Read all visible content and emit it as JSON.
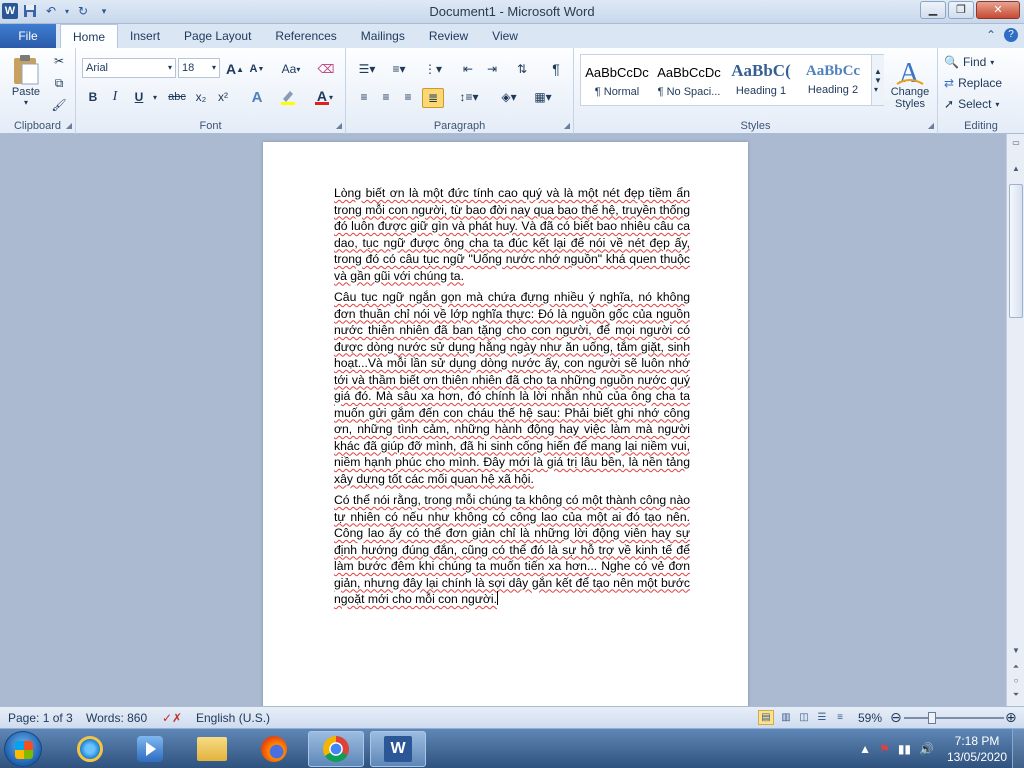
{
  "window": {
    "title": "Document1  -  Microsoft Word"
  },
  "qat": {
    "app_icon": "W",
    "save": "💾",
    "undo": "↶",
    "redo": "↻"
  },
  "tabs": {
    "file": "File",
    "items": [
      "Home",
      "Insert",
      "Page Layout",
      "References",
      "Mailings",
      "Review",
      "View"
    ],
    "active": "Home"
  },
  "ribbon": {
    "clipboard": {
      "label": "Clipboard",
      "paste": "Paste"
    },
    "font": {
      "label": "Font",
      "name": "Arial",
      "size": "18",
      "bold": "B",
      "italic": "I",
      "underline": "U",
      "strike": "abc",
      "sub": "x₂",
      "sup": "x²",
      "grow": "A",
      "shrink": "A",
      "case": "Aa",
      "color": "A"
    },
    "paragraph": {
      "label": "Paragraph",
      "pilcrow": "¶"
    },
    "styles": {
      "label": "Styles",
      "items": [
        {
          "preview": "AaBbCcDc",
          "name": "¶ Normal"
        },
        {
          "preview": "AaBbCcDc",
          "name": "¶ No Spaci..."
        },
        {
          "preview": "AaBbC(",
          "name": "Heading 1"
        },
        {
          "preview": "AaBbCc",
          "name": "Heading 2"
        }
      ],
      "change_styles": "Change Styles"
    },
    "editing": {
      "label": "Editing",
      "find": "Find",
      "replace": "Replace",
      "select": "Select"
    }
  },
  "document": {
    "paragraphs": [
      "Lòng biết ơn là một đức tính cao quý và là một nét đẹp tiềm ẩn trong mỗi con người, từ bao đời nay qua bao thế hệ, truyền thống đó luôn được giữ gìn và phát huy. Và đã có biết bao nhiêu câu ca dao, tục ngữ được ông cha ta đúc kết lại để nói về nét đẹp ấy, trong đó có câu tục ngữ \"Uống nước nhớ nguồn\" khá quen thuộc và gần gũi với chúng ta.",
      "Câu tục ngữ ngắn gọn mà chứa đựng nhiều ý nghĩa, nó không đơn thuần chỉ nói về lớp nghĩa thực: Đó là nguồn gốc của nguồn nước thiên nhiên đã ban tặng cho con người, để mọi người có được dòng nước sử dụng hằng ngày như ăn uống, tắm giặt, sinh hoạt...Và mỗi lần sử dụng dòng nước ấy, con người sẽ luôn nhớ tới và thầm biết ơn thiên nhiên đã cho ta những nguồn nước quý giá đó. Mà sâu xa hơn, đó chính là lời nhắn nhủ của ông cha ta muốn gửi gắm đến con cháu thế hệ sau: Phải biết ghi nhớ công ơn, những tình cảm, những hành động hay việc làm mà người khác đã giúp đỡ mình, đã hi sinh cống hiến để mang lại niềm vui, niềm hạnh phúc cho mình. Đây mới là giá trị lâu bền, là nền tảng xây dựng tốt các mối quan hệ xã hội.",
      "Có thể nói rằng, trong mỗi chúng ta không có một thành công nào tự nhiên có nếu như không có công lao của một ai đó tạo nên. Công lao ấy có thể đơn giản chỉ là những lời động viên hay sự định hướng đúng đắn, cũng có thể đó là sự hỗ trợ về kinh tế để làm bước đêm khi chúng ta muốn tiến xa hơn... Nghe có vẻ đơn giản, nhưng đây lại chính là sợi dây gắn kết để tạo nên một bước ngoặt mới cho mỗi con người."
    ]
  },
  "status": {
    "page": "Page: 1 of 3",
    "words": "Words: 860",
    "language": "English (U.S.)",
    "zoom": "59%"
  },
  "taskbar": {
    "time": "7:18 PM",
    "date": "13/05/2020"
  },
  "colors": {
    "accent": "#2b5797",
    "file_tab": "#2a5ba9",
    "ribbon": "#e4ecf7"
  }
}
